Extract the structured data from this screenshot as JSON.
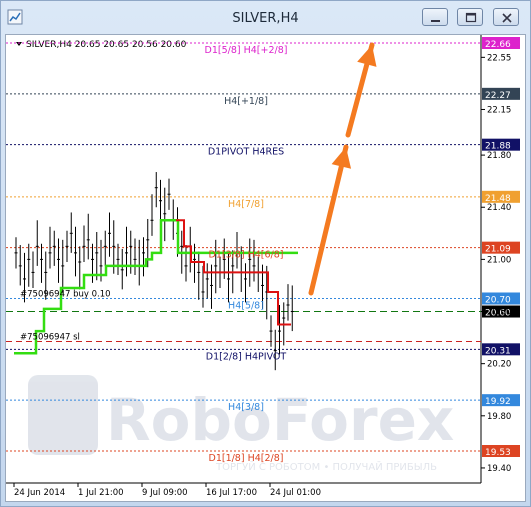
{
  "window": {
    "title": "SILVER,H4"
  },
  "chart_header": "SILVER,H4  20.65 20.65 20.56 20.60",
  "watermark": "RoboForex",
  "watermark_sub": "ТОРГУЙ С РОБОТОМ • ПОЛУЧАЙ ПРИБЫЛЬ",
  "colors": {
    "green_line": "#33dd11",
    "red_line": "#dd1111",
    "arrow": "#f47a20",
    "blue_level": "#2277cc"
  },
  "levels": [
    {
      "label": "D1[5/8] H4[+2/8]",
      "value": 22.66,
      "price_label": "22.66",
      "color": "#dd22cc"
    },
    {
      "label": "H4[+1/8]",
      "value": 22.27,
      "price_label": "22.27",
      "color": "#334455"
    },
    {
      "label": "D1PIVOT H4RES",
      "value": 21.88,
      "price_label": "21.88",
      "color": "#111166"
    },
    {
      "label": "H4[7/8]",
      "value": 21.48,
      "price_label": "21.48",
      "color": "#f0a030"
    },
    {
      "label": "D1[3/8] H4[6/8]",
      "value": 21.09,
      "price_label": "21.09",
      "color": "#dd4422"
    },
    {
      "label": "H4[5/8]",
      "value": 20.7,
      "price_label": "20.70",
      "color": "#3388dd"
    },
    {
      "label": "D1[2/8] H4PIVOT",
      "value": 20.31,
      "price_label": "20.31",
      "color": "#111166"
    },
    {
      "label": "H4[3/8]",
      "value": 19.92,
      "price_label": "19.92",
      "color": "#3388dd"
    },
    {
      "label": "D1[1/8] H4[2/8]",
      "value": 19.53,
      "price_label": "19.53",
      "color": "#dd4422"
    }
  ],
  "current_price": {
    "value": 20.6,
    "label": "20.60"
  },
  "order_labels": [
    {
      "text": "#75096947 buy 0.10",
      "value": 20.7
    },
    {
      "text": "#75096947 sl",
      "value": 20.37
    }
  ],
  "y_ticks": [
    "22.55",
    "22.15",
    "21.80",
    "21.40",
    "21.00",
    "20.60",
    "20.20",
    "19.80",
    "19.40"
  ],
  "y_tick_values": [
    22.55,
    22.15,
    21.8,
    21.4,
    21.0,
    20.6,
    20.2,
    19.8,
    19.4
  ],
  "x_ticks": [
    "24 Jun 2014",
    "1 Jul 21:00",
    "9 Jul 09:00",
    "16 Jul 17:00",
    "24 Jul 01:00"
  ]
}
